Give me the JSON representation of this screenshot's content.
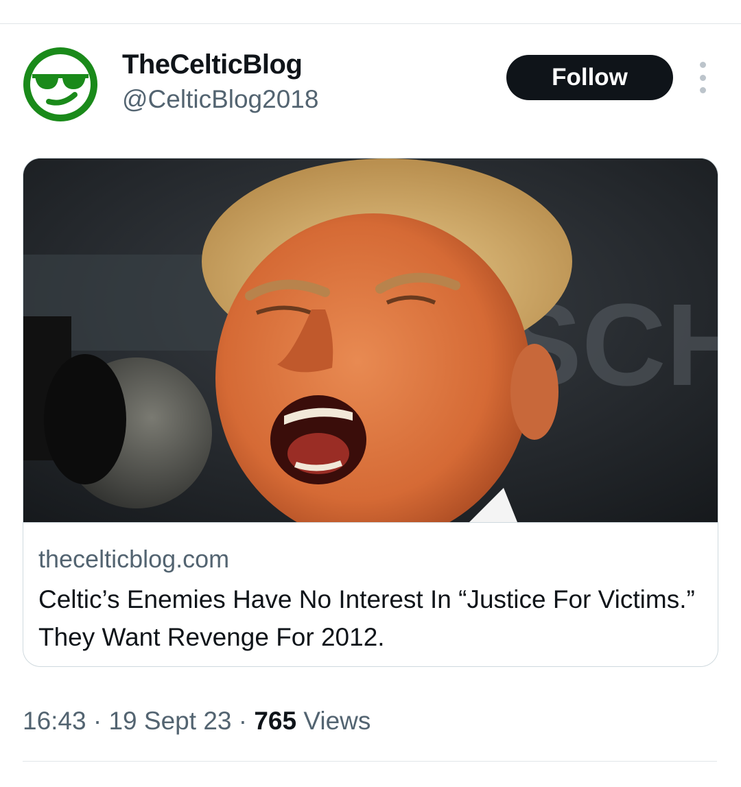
{
  "author": {
    "display_name": "TheCelticBlog",
    "handle": "@CelticBlog2018",
    "avatar_icon": "sunglasses-smiley-icon",
    "avatar_color": "#1a8a1a"
  },
  "actions": {
    "follow_label": "Follow",
    "more_icon": "more-options-icon"
  },
  "link_card": {
    "domain": "theceltic blog.com",
    "headline": "Celtic’s Enemies Have No Interest In “Justice For Victims.” They Want Revenge For 2012."
  },
  "meta": {
    "time": "16:43",
    "separator": "·",
    "date": "19 Sept 23",
    "views_count": "765",
    "views_label": "Views"
  },
  "colors": {
    "text_primary": "#0f1419",
    "text_secondary": "#536471",
    "follow_bg": "#0f1419",
    "border": "#cfd9de"
  }
}
